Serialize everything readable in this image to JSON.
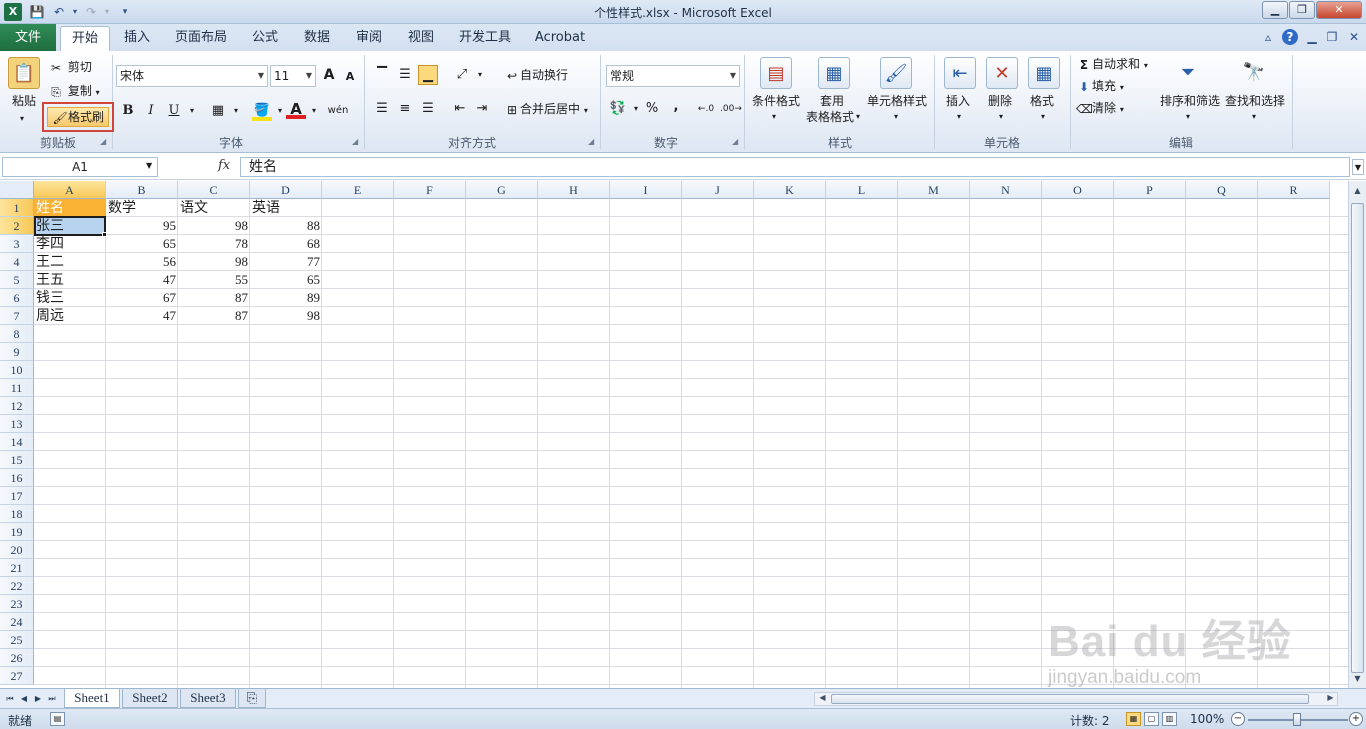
{
  "window": {
    "title": "个性样式.xlsx - Microsoft Excel",
    "app_icon_letter": "X"
  },
  "tabs": {
    "file": "文件",
    "items": [
      "开始",
      "插入",
      "页面布局",
      "公式",
      "数据",
      "审阅",
      "视图",
      "开发工具",
      "Acrobat"
    ],
    "active_index": 0
  },
  "ribbon": {
    "clipboard": {
      "label": "剪贴板",
      "paste": "粘贴",
      "cut": "剪切",
      "copy": "复制",
      "format_painter": "格式刷"
    },
    "font": {
      "label": "字体",
      "font_name": "宋体",
      "font_size": "11",
      "bold": "B",
      "italic": "I",
      "underline": "U",
      "grow": "A",
      "shrink": "A",
      "font_color": "A",
      "phonetic": "wén"
    },
    "alignment": {
      "label": "对齐方式",
      "wrap_text": "自动换行",
      "merge_center": "合并后居中"
    },
    "number": {
      "label": "数字",
      "format": "常规",
      "percent": "%",
      "comma": ","
    },
    "styles": {
      "label": "样式",
      "conditional": "条件格式",
      "table_line1": "套用",
      "table_line2": "表格格式",
      "cell_styles": "单元格样式"
    },
    "cells": {
      "label": "单元格",
      "insert": "插入",
      "delete": "删除",
      "format": "格式"
    },
    "editing": {
      "label": "编辑",
      "autosum": "自动求和",
      "fill": "填充",
      "clear": "清除",
      "sort_filter": "排序和筛选",
      "find_select": "查找和选择"
    }
  },
  "formula_bar": {
    "name_box": "A1",
    "fx": "fx",
    "content": "姓名"
  },
  "grid": {
    "columns": [
      "A",
      "B",
      "C",
      "D",
      "E",
      "F",
      "G",
      "H",
      "I",
      "J",
      "K",
      "L",
      "M",
      "N",
      "O",
      "P",
      "Q",
      "R"
    ],
    "row_count": 27,
    "header_row": [
      "姓名",
      "数学",
      "语文",
      "英语"
    ],
    "rows": [
      [
        "张三",
        "95",
        "98",
        "88"
      ],
      [
        "李四",
        "65",
        "78",
        "68"
      ],
      [
        "王二",
        "56",
        "98",
        "77"
      ],
      [
        "王五",
        "47",
        "55",
        "65"
      ],
      [
        "钱三",
        "67",
        "87",
        "89"
      ],
      [
        "周远",
        "47",
        "87",
        "98"
      ]
    ]
  },
  "sheets": {
    "items": [
      "Sheet1",
      "Sheet2",
      "Sheet3"
    ],
    "active_index": 0
  },
  "status": {
    "ready": "就绪",
    "count": "计数: 2",
    "zoom": "100%"
  },
  "watermark": {
    "brand": "Bai du 经验",
    "url": "jingyan.baidu.com"
  },
  "colors": {
    "file_tab": "#1e6e3f",
    "selection_a1": "#f9b233",
    "selection_a2": "#b8d3f0",
    "highlight_box": "#d0453a"
  }
}
